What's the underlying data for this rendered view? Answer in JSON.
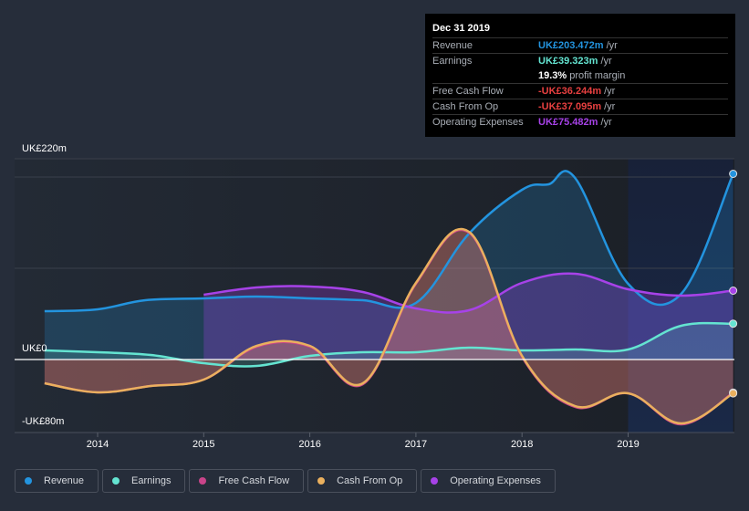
{
  "tooltip": {
    "date": "Dec 31 2019",
    "rows": [
      {
        "label": "Revenue",
        "value": "UK£203.472m",
        "unit": "/yr",
        "color": "#2394df"
      },
      {
        "label": "Earnings",
        "value": "UK£39.323m",
        "unit": "/yr",
        "color": "#64e4d1"
      },
      {
        "label": "",
        "value": "19.3%",
        "unit": "profit margin",
        "color": "#ffffff"
      },
      {
        "label": "Free Cash Flow",
        "value": "-UK£36.244m",
        "unit": "/yr",
        "color": "#e84040"
      },
      {
        "label": "Cash From Op",
        "value": "-UK£37.095m",
        "unit": "/yr",
        "color": "#e84040"
      },
      {
        "label": "Operating Expenses",
        "value": "UK£75.482m",
        "unit": "/yr",
        "color": "#a742e8"
      }
    ]
  },
  "legend": [
    {
      "label": "Revenue",
      "color": "#2394df"
    },
    {
      "label": "Earnings",
      "color": "#64e4d1"
    },
    {
      "label": "Free Cash Flow",
      "color": "#c9448a"
    },
    {
      "label": "Cash From Op",
      "color": "#eab05e"
    },
    {
      "label": "Operating Expenses",
      "color": "#a742e8"
    }
  ],
  "chart_data": {
    "type": "area",
    "title": "",
    "xlabel": "",
    "ylabel": "",
    "ylim": [
      -80,
      220
    ],
    "xlim": [
      2013.5,
      2019.99
    ],
    "y_tick_labels": [
      "UK£220m",
      "UK£0",
      "-UK£80m"
    ],
    "y_ticks": [
      220,
      0,
      -80
    ],
    "y_gridlines": [
      220,
      200,
      100,
      0,
      -80
    ],
    "x_tick_labels": [
      "2014",
      "2015",
      "2016",
      "2017",
      "2018",
      "2019"
    ],
    "x_ticks": [
      2014,
      2015,
      2016,
      2017,
      2018,
      2019
    ],
    "highlight_range": [
      2019,
      2019.99
    ],
    "grid": true,
    "legend_position": "bottom",
    "series": [
      {
        "name": "Revenue",
        "color": "#2394df",
        "x": [
          2013.5,
          2014,
          2014.45,
          2015,
          2015.5,
          2016,
          2016.5,
          2017,
          2017.5,
          2018,
          2018.25,
          2018.5,
          2019,
          2019.5,
          2019.99
        ],
        "values": [
          53,
          55,
          65,
          67,
          69,
          67,
          65,
          62,
          138,
          186,
          192,
          199,
          83,
          72,
          203.5
        ]
      },
      {
        "name": "Earnings",
        "color": "#64e4d1",
        "x": [
          2013.5,
          2014,
          2014.5,
          2015,
          2015.5,
          2016,
          2016.5,
          2017,
          2017.5,
          2018,
          2018.5,
          2019,
          2019.5,
          2019.99
        ],
        "values": [
          10,
          8,
          5,
          -4,
          -7,
          4,
          8,
          8,
          13,
          10,
          11,
          11,
          37,
          39.3
        ]
      },
      {
        "name": "Free Cash Flow",
        "color": "#c9448a",
        "x": [
          2013.5,
          2014,
          2014.5,
          2015,
          2015.5,
          2016,
          2016.5,
          2017,
          2017.5,
          2018,
          2018.5,
          2019,
          2019.5,
          2019.99
        ],
        "values": [
          -26,
          -36,
          -29,
          -22,
          14,
          14,
          -27,
          83,
          139,
          3,
          -52,
          -37,
          -71,
          -36.2
        ]
      },
      {
        "name": "Cash From Op",
        "color": "#eab05e",
        "x": [
          2013.5,
          2014,
          2014.5,
          2015,
          2015.5,
          2016,
          2016.5,
          2017,
          2017.5,
          2018,
          2018.5,
          2019,
          2019.5,
          2019.99
        ],
        "values": [
          -26,
          -36,
          -29,
          -22,
          15,
          15,
          -26,
          84,
          140,
          4,
          -51,
          -37,
          -70,
          -37.1
        ]
      },
      {
        "name": "Operating Expenses",
        "color": "#a742e8",
        "x": [
          2015,
          2015.5,
          2016,
          2016.5,
          2017,
          2017.5,
          2018,
          2018.5,
          2019,
          2019.5,
          2019.99
        ],
        "values": [
          71,
          79,
          80,
          74,
          56,
          54,
          84,
          94,
          77,
          70,
          75.5
        ]
      }
    ]
  }
}
